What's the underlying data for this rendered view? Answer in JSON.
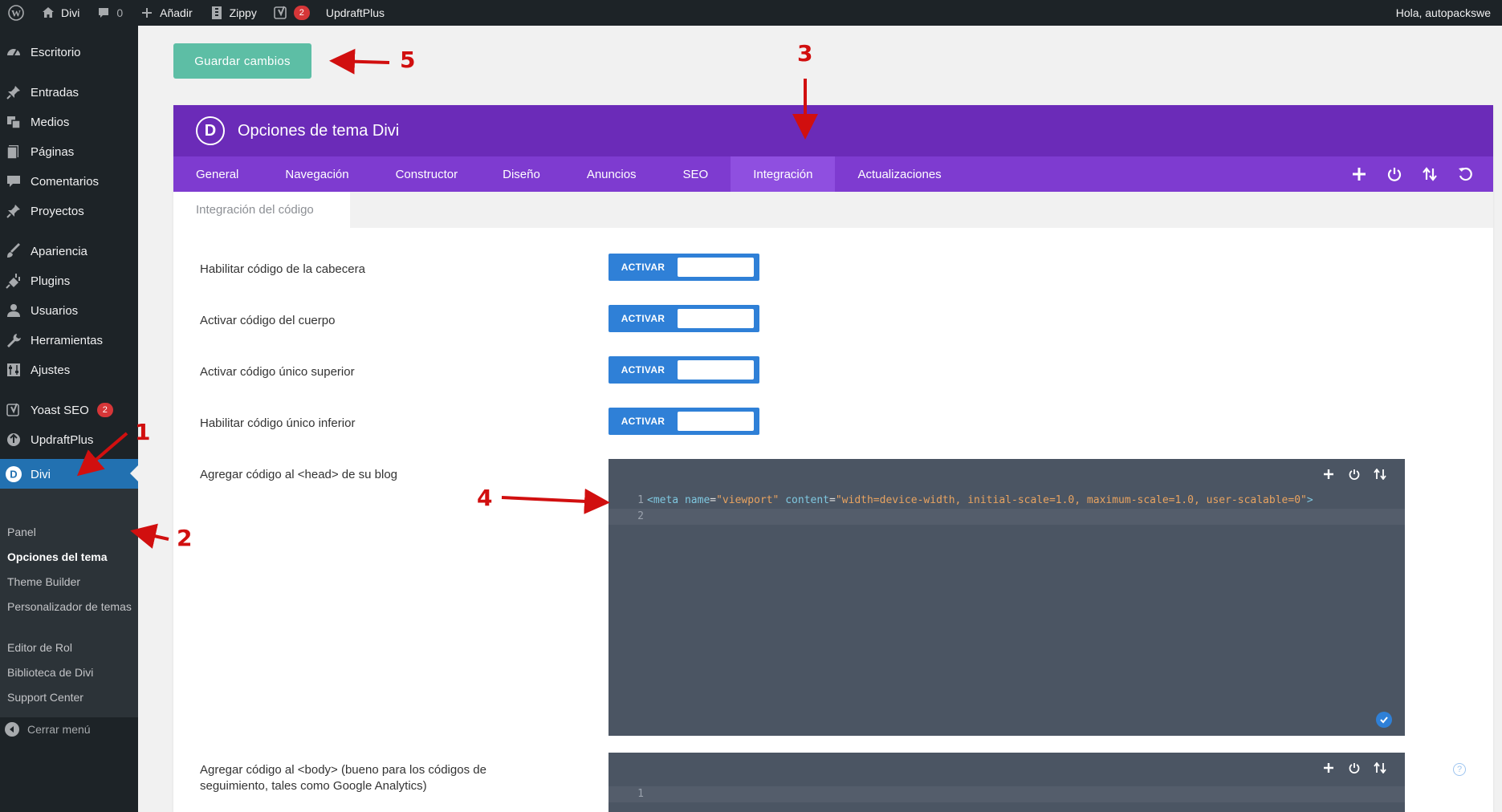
{
  "admin_bar": {
    "site_name": "Divi",
    "comments_count": "0",
    "new_label": "Añadir",
    "zippy_label": "Zippy",
    "yoast_count": "2",
    "updraft_label": "UpdraftPlus",
    "greeting": "Hola, autopackswe"
  },
  "sidebar": {
    "items": [
      {
        "label": "Escritorio",
        "icon": "dashboard-icon"
      },
      {
        "label": "Entradas",
        "icon": "pin-icon"
      },
      {
        "label": "Medios",
        "icon": "media-icon"
      },
      {
        "label": "Páginas",
        "icon": "pages-icon"
      },
      {
        "label": "Comentarios",
        "icon": "comments-icon"
      },
      {
        "label": "Proyectos",
        "icon": "pin-icon"
      },
      {
        "label": "Apariencia",
        "icon": "brush-icon"
      },
      {
        "label": "Plugins",
        "icon": "plugin-icon"
      },
      {
        "label": "Usuarios",
        "icon": "users-icon"
      },
      {
        "label": "Herramientas",
        "icon": "wrench-icon"
      },
      {
        "label": "Ajustes",
        "icon": "settings-icon"
      },
      {
        "label": "Yoast SEO",
        "icon": "yoast-icon",
        "badge": "2"
      },
      {
        "label": "UpdraftPlus",
        "icon": "updraft-icon"
      },
      {
        "label": "Divi",
        "icon": "divi-icon"
      }
    ],
    "submenu": [
      "Panel",
      "Opciones del tema",
      "Theme Builder",
      "Personalizador de temas",
      "Editor de Rol",
      "Biblioteca de Divi",
      "Support Center"
    ],
    "collapse_label": "Cerrar menú"
  },
  "save_button": "Guardar cambios",
  "panel": {
    "title": "Opciones de tema Divi",
    "logo_letter": "D",
    "tabs": [
      "General",
      "Navegación",
      "Constructor",
      "Diseño",
      "Anuncios",
      "SEO",
      "Integración",
      "Actualizaciones"
    ],
    "active_tab": "Integración",
    "subtab": "Integración del código"
  },
  "options": [
    {
      "label": "Habilitar código de la cabecera",
      "toggle": "ACTIVAR"
    },
    {
      "label": "Activar código del cuerpo",
      "toggle": "ACTIVAR"
    },
    {
      "label": "Activar código único superior",
      "toggle": "ACTIVAR"
    },
    {
      "label": "Habilitar código único inferior",
      "toggle": "ACTIVAR"
    }
  ],
  "code_head": {
    "label": "Agregar código al <head> de su blog",
    "line1_no": "1",
    "line2_no": "2",
    "tag_open": "<meta",
    "attr1": "name",
    "val1": "\"viewport\"",
    "attr2": "content",
    "val2": "\"width=device-width, initial-scale=1.0, maximum-scale=1.0, user-scalable=0\"",
    "tag_close": ">"
  },
  "code_body": {
    "label": "Agregar código al <body> (bueno para los códigos de seguimiento, tales como Google Analytics)",
    "line1_no": "1"
  },
  "annotations": [
    "1",
    "2",
    "3",
    "4",
    "5"
  ],
  "colors": {
    "header_purple": "#6b2bb8",
    "tab_purple": "#7e3bd0",
    "save_green": "#5dbea5",
    "toggle_blue": "#2f80d7",
    "annotation_red": "#d10f0f"
  }
}
